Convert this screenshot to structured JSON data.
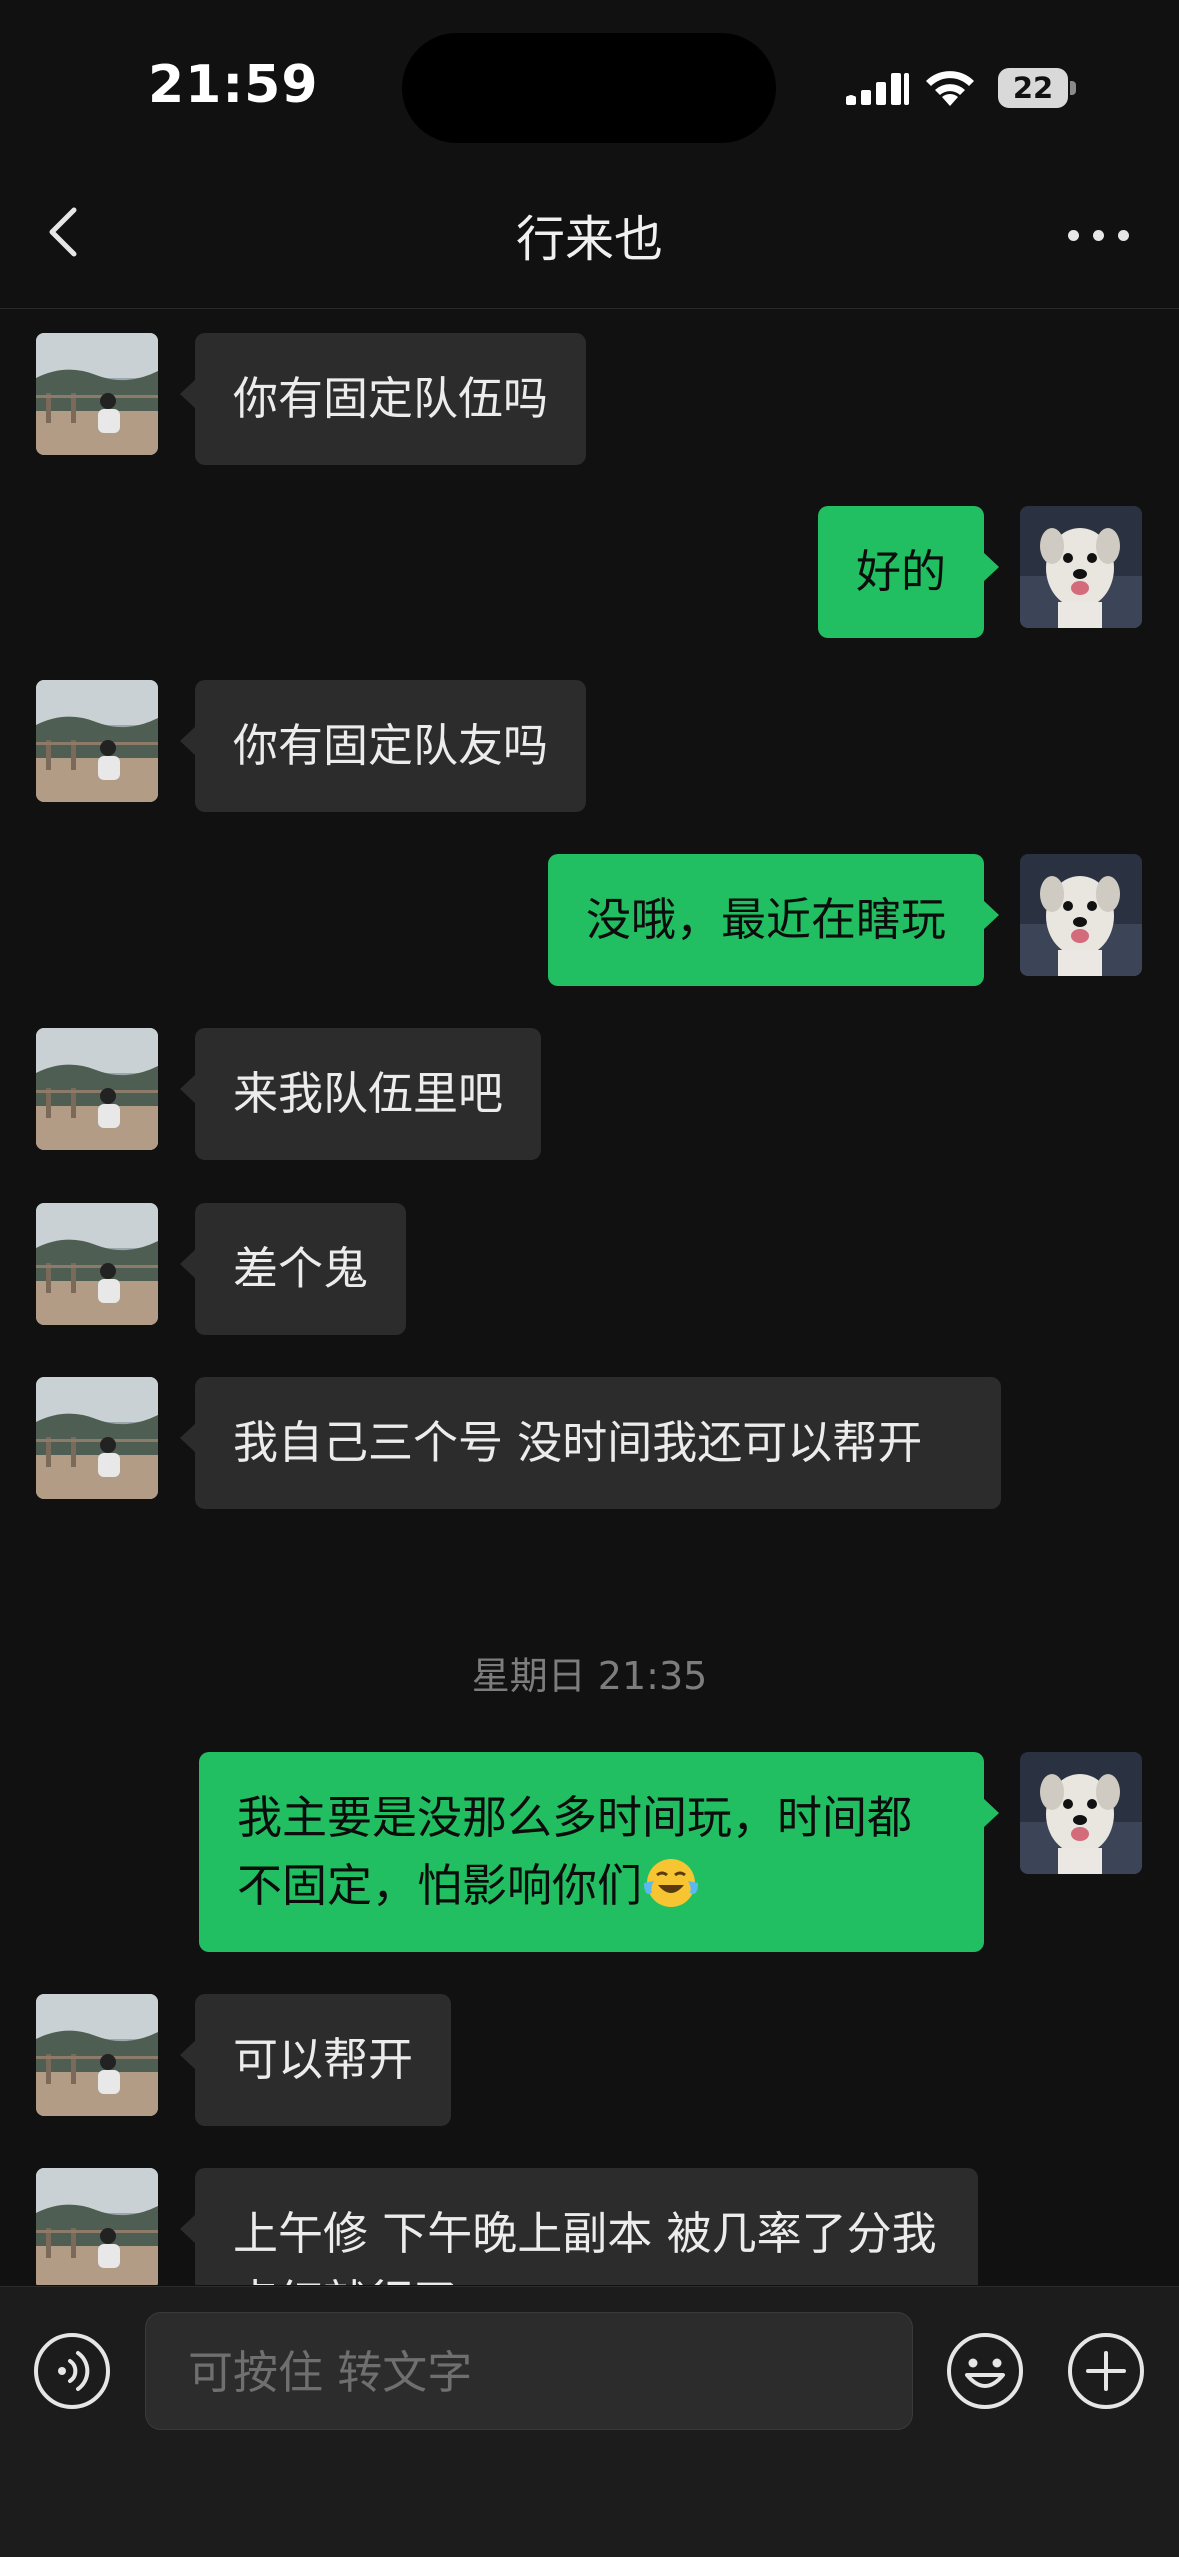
{
  "status_bar": {
    "time": "21:59",
    "battery": "22"
  },
  "header": {
    "title": "行来也"
  },
  "messages": [
    {
      "side": "left",
      "text": "你有固定队伍吗"
    },
    {
      "side": "right",
      "text": "好的"
    },
    {
      "side": "left",
      "text": "你有固定队友吗"
    },
    {
      "side": "right",
      "text": "没哦，最近在瞎玩"
    },
    {
      "side": "left",
      "text": "来我队伍里吧"
    },
    {
      "side": "left",
      "text": "差个鬼"
    },
    {
      "side": "left",
      "text": "我自己三个号  没时间我还可以帮开"
    },
    {
      "side": "right",
      "text": "我主要是没那么多时间玩，时间都不固定，怕影响你们",
      "trailing_emoji": "laughing-crying-emoji"
    },
    {
      "side": "left",
      "text": "可以帮开"
    },
    {
      "side": "left",
      "text": "上午修  下午晚上副本  被几率了分我点红就行了"
    }
  ],
  "timestamp": "星期日 21:35",
  "input_bar": {
    "placeholder": "可按住 转文字"
  },
  "colors": {
    "background": "#111111",
    "incoming_bubble": "#2c2c2c",
    "outgoing_bubble": "#21bf62",
    "input_bar": "#1c1c1c"
  }
}
